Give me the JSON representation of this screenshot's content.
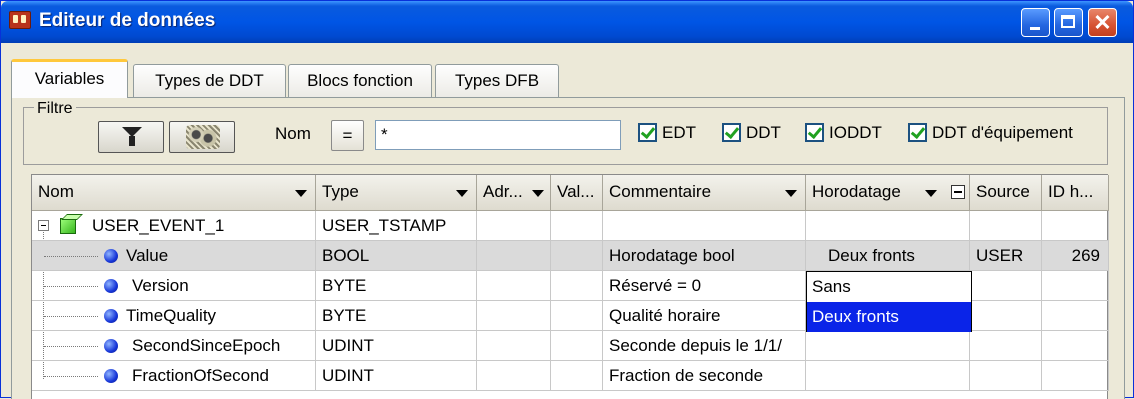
{
  "window": {
    "title": "Editeur de données"
  },
  "tabs": [
    {
      "label": "Variables",
      "active": true
    },
    {
      "label": "Types de DDT",
      "active": false
    },
    {
      "label": "Blocs fonction",
      "active": false
    },
    {
      "label": "Types DFB",
      "active": false
    }
  ],
  "filter": {
    "legend": "Filtre",
    "name_label": "Nom",
    "equals_label": "=",
    "value": "*",
    "checkboxes": [
      {
        "label": "EDT",
        "checked": true
      },
      {
        "label": "DDT",
        "checked": true
      },
      {
        "label": "IODDT",
        "checked": true
      },
      {
        "label": "DDT d'équipement",
        "checked": true
      }
    ]
  },
  "grid": {
    "columns": [
      "Nom",
      "Type",
      "Adr...",
      "Val...",
      "Commentaire",
      "Horodatage",
      "Source",
      "ID h..."
    ],
    "rows": [
      {
        "name": "USER_EVENT_1",
        "type": "USER_TSTAMP",
        "comment": "",
        "timestamp": "",
        "source": "",
        "id": ""
      },
      {
        "name": "Value",
        "type": "BOOL",
        "comment": "Horodatage bool",
        "timestamp": "Deux fronts",
        "source": "USER",
        "id": "269"
      },
      {
        "name": "Version",
        "type": "BYTE",
        "comment": "Réservé = 0",
        "timestamp": "",
        "source": "",
        "id": ""
      },
      {
        "name": "TimeQuality",
        "type": "BYTE",
        "comment": "Qualité horaire",
        "timestamp": "",
        "source": "",
        "id": ""
      },
      {
        "name": "SecondSinceEpoch",
        "type": "UDINT",
        "comment": "Seconde depuis le 1/1/",
        "timestamp": "",
        "source": "",
        "id": ""
      },
      {
        "name": "FractionOfSecond",
        "type": "UDINT",
        "comment": "Fraction de seconde",
        "timestamp": "",
        "source": "",
        "id": ""
      }
    ],
    "dropdown_options": [
      {
        "label": "Sans",
        "highlighted": false
      },
      {
        "label": "Deux fronts",
        "highlighted": true
      }
    ]
  },
  "colors": {
    "titlebar": "#0055E5",
    "tab_accent": "#FFC83C",
    "selection": "#0A24E8",
    "checkmark": "#21A121"
  }
}
